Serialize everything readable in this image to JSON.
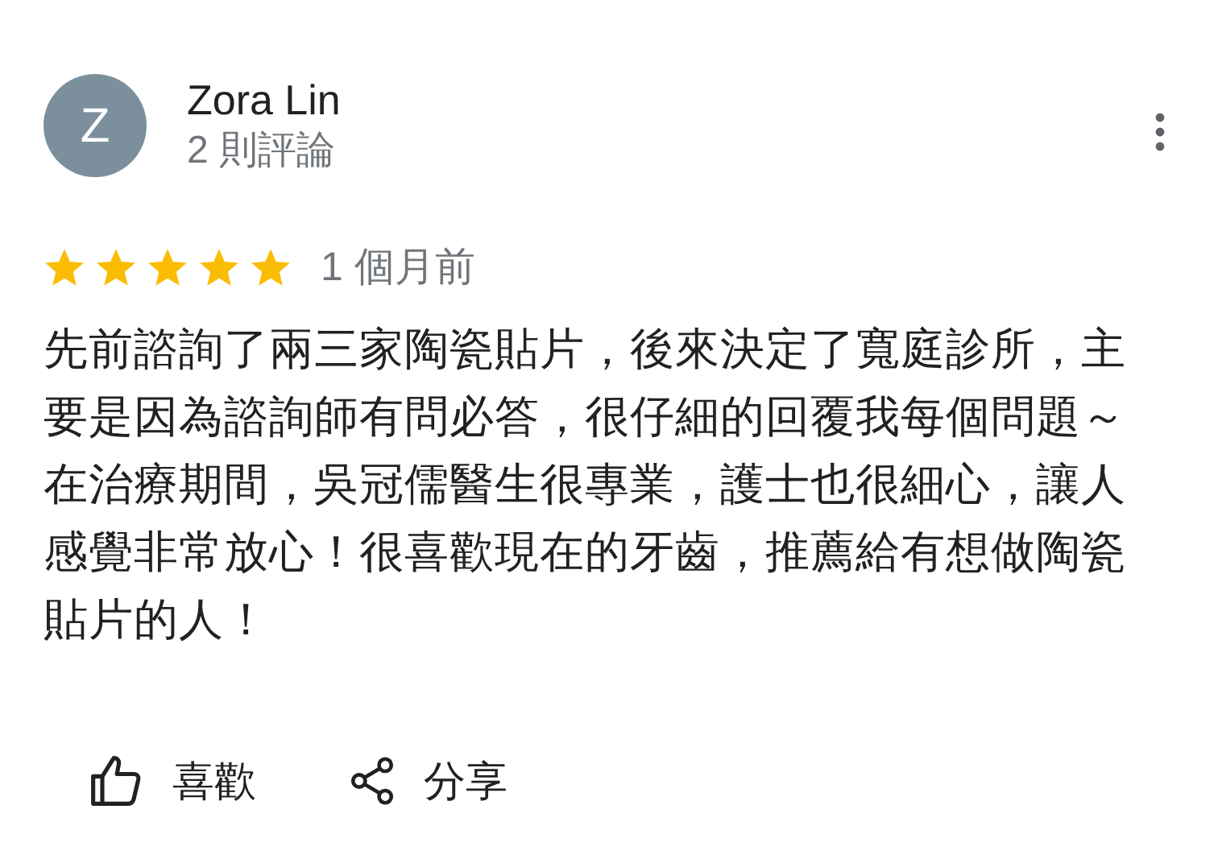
{
  "review": {
    "avatar": {
      "letter": "Z"
    },
    "reviewer": "Zora Lin",
    "review_count": "2 則評論",
    "stars": 5,
    "time": "1 個月前",
    "text": "先前諮詢了兩三家陶瓷貼片，後來決定了寬庭診所，主要是因為諮詢師有問必答，很仔細的回覆我每個問題～在治療期間，吳冠儒醫生很專業，護士也很細心，讓人感覺非常放心！很喜歡現在的牙齒，推薦給有想做陶瓷貼片的人！",
    "actions": [
      {
        "kind": "like",
        "label": "喜歡"
      },
      {
        "kind": "share",
        "label": "分享"
      }
    ]
  }
}
